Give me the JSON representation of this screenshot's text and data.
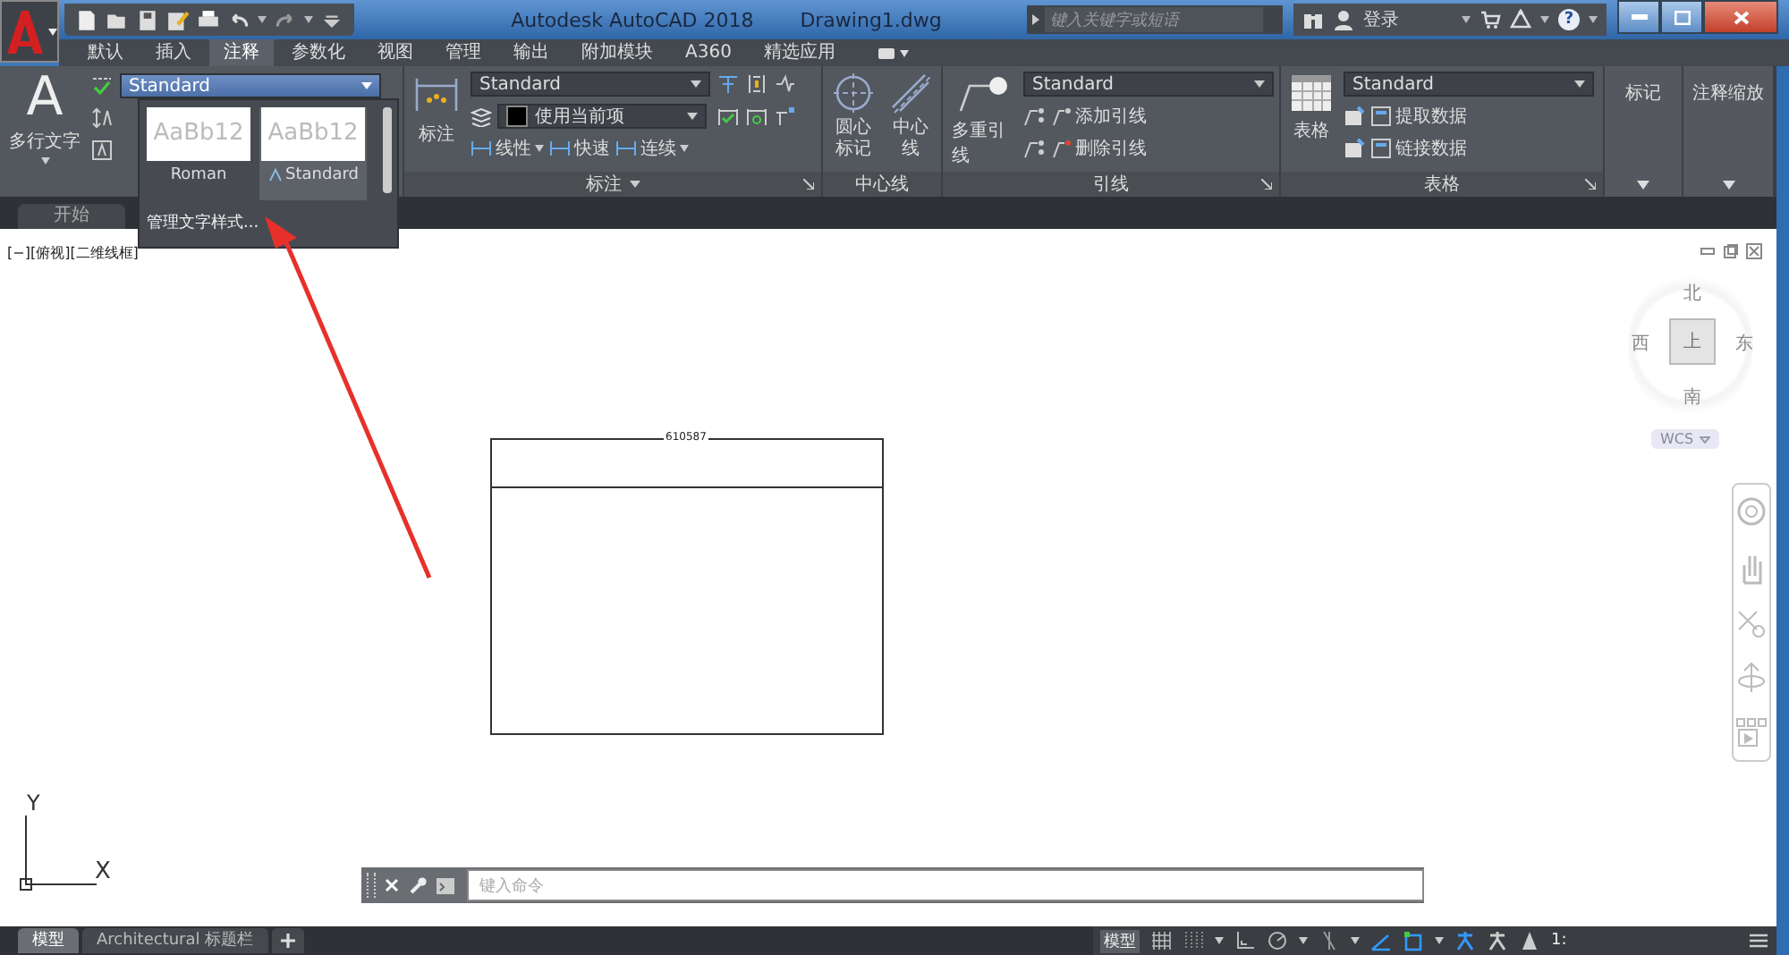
{
  "window": {
    "title": "Autodesk AutoCAD 2018",
    "document": "Drawing1.dwg"
  },
  "search": {
    "placeholder": "键入关键字或短语"
  },
  "account": {
    "login": "登录",
    "help": "?"
  },
  "ribbon_tabs": [
    {
      "label": "默认",
      "selected": false
    },
    {
      "label": "插入",
      "selected": false
    },
    {
      "label": "注释",
      "selected": true
    },
    {
      "label": "参数化",
      "selected": false
    },
    {
      "label": "视图",
      "selected": false
    },
    {
      "label": "管理",
      "selected": false
    },
    {
      "label": "输出",
      "selected": false
    },
    {
      "label": "附加模块",
      "selected": false
    },
    {
      "label": "A360",
      "selected": false
    },
    {
      "label": "精选应用",
      "selected": false
    }
  ],
  "text_panel": {
    "glyph": "A",
    "button": "多行文字",
    "style": "Standard"
  },
  "style_gallery": {
    "styles": [
      {
        "preview": "AaBb12",
        "name": "Roman",
        "selected": false
      },
      {
        "preview": "AaBb12",
        "name": "Standard",
        "selected": true
      }
    ],
    "manage": "管理文字样式..."
  },
  "dimension_panel": {
    "button": "标注",
    "style": "Standard",
    "layer": "使用当前项",
    "tools": [
      "线性",
      "快速",
      "连续"
    ],
    "title": "标注"
  },
  "centerline_panel": {
    "buttons": [
      "圆心标记",
      "中心线"
    ],
    "title": "中心线"
  },
  "leader_panel": {
    "button": "多重引线",
    "style": "Standard",
    "tools": [
      "添加引线",
      "删除引线"
    ],
    "title": "引线"
  },
  "table_panel": {
    "button": "表格",
    "style": "Standard",
    "tools": [
      "提取数据",
      "链接数据"
    ],
    "title": "表格"
  },
  "collapsed_panels": [
    "标记",
    "注释缩放"
  ],
  "doc_tabs": [
    {
      "label": "开始",
      "selected": false
    }
  ],
  "viewport": {
    "label": "[−][俯视][二维线框]",
    "compass": {
      "north": "北",
      "south": "南",
      "east": "东",
      "west": "西",
      "face": "上"
    },
    "ucs_menu": "WCS"
  },
  "drawing": {
    "title_text": "610587"
  },
  "ucs": {
    "x": "X",
    "y": "Y"
  },
  "command": {
    "placeholder": "键入命令"
  },
  "layout_tabs": [
    {
      "label": "模型",
      "selected": true
    },
    {
      "label": "Architectural 标题栏",
      "selected": false
    }
  ],
  "status_bar": {
    "space": "模型",
    "scale": "1:"
  }
}
